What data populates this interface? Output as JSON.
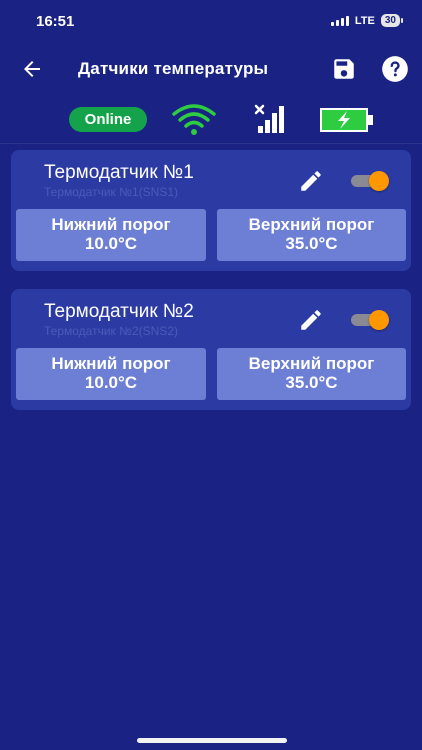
{
  "status_bar": {
    "time": "16:51",
    "network": "LTE",
    "battery_level": "30"
  },
  "app_bar": {
    "title": "Датчики температуры"
  },
  "indicators": {
    "online_label": "Online"
  },
  "sensors": [
    {
      "name": "Термодатчик №1",
      "subtitle": "Термодатчик №1(SNS1)",
      "enabled": true,
      "low_label": "Нижний порог",
      "low_value": "10.0°C",
      "high_label": "Верхний порог",
      "high_value": "35.0°C"
    },
    {
      "name": "Термодатчик №2",
      "subtitle": "Термодатчик №2(SNS2)",
      "enabled": true,
      "low_label": "Нижний порог",
      "low_value": "10.0°C",
      "high_label": "Верхний порог",
      "high_value": "35.0°C"
    }
  ],
  "colors": {
    "background": "#1a2384",
    "card": "#2b3ba3",
    "threshold_button": "#6d7fd4",
    "online": "#14a34a",
    "toggle_on": "#ff9800",
    "battery_charging": "#2ecc40"
  },
  "icons": [
    "back-arrow-icon",
    "save-icon",
    "help-icon",
    "wifi-icon",
    "cellular-no-signal-icon",
    "battery-charging-icon",
    "edit-icon"
  ]
}
